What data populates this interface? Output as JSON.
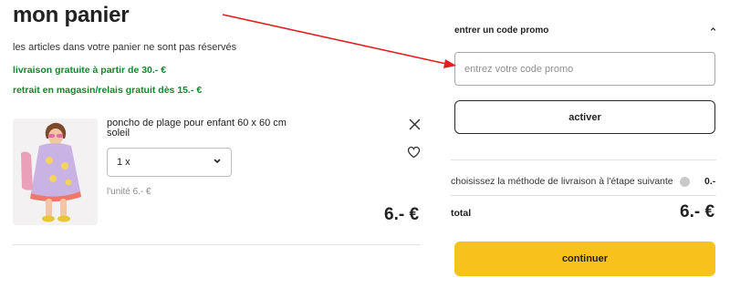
{
  "cart": {
    "title": "mon panier",
    "notice": "les articles dans votre panier ne sont pas réservés",
    "shipping_promos": [
      "livraison gratuite à partir de 30.- €",
      "retrait en magasin/relais gratuit dès 15.- €"
    ],
    "item": {
      "name": "poncho de plage pour enfant 60 x 60 cm soleil",
      "quantity": "1 x",
      "unit_price": "l'unité 6.- €",
      "total": "6.- €"
    }
  },
  "summary": {
    "promo_heading": "entrer un code promo",
    "promo_placeholder": "entrez votre code promo",
    "activate_label": "activer",
    "shipping_label": "choisissez la méthode de livraison à l'étape suivante",
    "shipping_value": "0.-",
    "total_label": "total",
    "total_value": "6.- €",
    "continue_label": "continuer"
  },
  "colors": {
    "accent_yellow": "#f7c21b",
    "promo_green": "#0c8a2b",
    "annotation_arrow": "#e02020"
  },
  "icons": [
    "close-icon",
    "heart-icon",
    "chevron-down-icon",
    "chevron-up-icon",
    "info-icon"
  ]
}
